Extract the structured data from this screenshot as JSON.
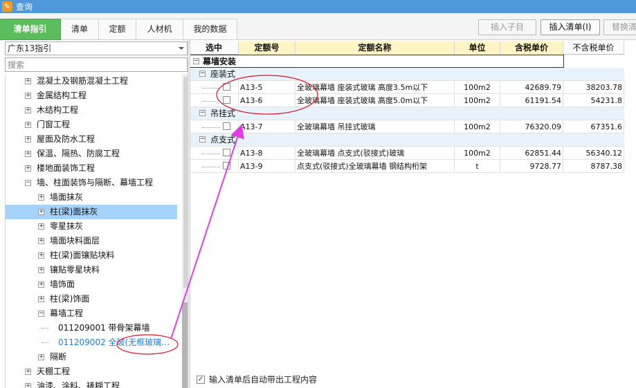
{
  "window": {
    "title": "查询"
  },
  "tabs": [
    {
      "label": "清单指引"
    },
    {
      "label": "清单"
    },
    {
      "label": "定额"
    },
    {
      "label": "人材机"
    },
    {
      "label": "我的数据"
    }
  ],
  "toolbar": {
    "insert_child": "插入子目",
    "insert_list": "插入清单(I)",
    "replace": "替换清"
  },
  "left": {
    "combo_value": "广东13指引",
    "search_placeholder": "搜索",
    "tree": [
      {
        "label": "混凝土及钢筋混凝土工程",
        "level": 0,
        "exp": "+"
      },
      {
        "label": "金属结构工程",
        "level": 0,
        "exp": "+"
      },
      {
        "label": "木结构工程",
        "level": 0,
        "exp": "+"
      },
      {
        "label": "门窗工程",
        "level": 0,
        "exp": "+"
      },
      {
        "label": "屋面及防水工程",
        "level": 0,
        "exp": "+"
      },
      {
        "label": "保温、隔热、防腐工程",
        "level": 0,
        "exp": "+"
      },
      {
        "label": "楼地面装饰工程",
        "level": 0,
        "exp": "+"
      },
      {
        "label": "墙、柱面装饰与隔断、幕墙工程",
        "level": 0,
        "exp": "−"
      },
      {
        "label": "墙面抹灰",
        "level": 1,
        "exp": "+"
      },
      {
        "label": "柱(梁)面抹灰",
        "level": 1,
        "exp": "+",
        "selected": true
      },
      {
        "label": "零星抹灰",
        "level": 1,
        "exp": "+"
      },
      {
        "label": "墙面块料面层",
        "level": 1,
        "exp": "+"
      },
      {
        "label": "柱(梁)面镶贴块料",
        "level": 1,
        "exp": "+"
      },
      {
        "label": "镶贴零星块料",
        "level": 1,
        "exp": "+"
      },
      {
        "label": "墙饰面",
        "level": 1,
        "exp": "+"
      },
      {
        "label": "柱(梁)饰面",
        "level": 1,
        "exp": "+"
      },
      {
        "label": "幕墙工程",
        "level": 1,
        "exp": "−"
      },
      {
        "label": "011209001   带骨架幕墙",
        "level": 2,
        "exp": ""
      },
      {
        "label": "011209002   全玻(无框玻璃…",
        "level": 2,
        "exp": "",
        "blue": true
      },
      {
        "label": "隔断",
        "level": 1,
        "exp": "+"
      },
      {
        "label": "天棚工程",
        "level": 0,
        "exp": "+"
      },
      {
        "label": "油漆、涂料、裱糊工程",
        "level": 0,
        "exp": "+"
      }
    ]
  },
  "grid": {
    "headers": [
      "选中",
      "定额号",
      "定额名称",
      "单位",
      "含税单价",
      "不含税单价"
    ],
    "top_group": "幕墙安装",
    "sections": [
      {
        "label": "座装式",
        "rows": [
          {
            "code": "A13-5",
            "name": "全玻璃幕墙 座装式玻璃 高度3.5m以下",
            "unit": "100m2",
            "tax": "42689.79",
            "notax": "38203.78"
          },
          {
            "code": "A13-6",
            "name": "全玻璃幕墙 座装式玻璃 高度5.0m以下",
            "unit": "100m2",
            "tax": "61191.54",
            "notax": "54231.8"
          }
        ]
      },
      {
        "label": "吊挂式",
        "rows": [
          {
            "code": "A13-7",
            "name": "全玻璃幕墙 吊挂式玻璃",
            "unit": "100m2",
            "tax": "76320.09",
            "notax": "67351.6"
          }
        ]
      },
      {
        "label": "点支式",
        "rows": [
          {
            "code": "A13-8",
            "name": "全玻璃幕墙 点支式(驳接式)玻璃",
            "unit": "100m2",
            "tax": "62851.44",
            "notax": "56340.12"
          },
          {
            "code": "A13-9",
            "name": "点支式(驳接式)全玻璃幕墙 钢结构桁架",
            "unit": "t",
            "tax": "9728.77",
            "notax": "8787.38"
          }
        ]
      }
    ]
  },
  "bottom": {
    "auto_bring_label": "输入清单后自动带出工程内容",
    "checked_mark": "✓"
  },
  "colors": {
    "title_bar": "#4d99db",
    "tab_active": "#5bbd5b",
    "annotation": "#e0102a",
    "arrow": "#e23ce6"
  }
}
